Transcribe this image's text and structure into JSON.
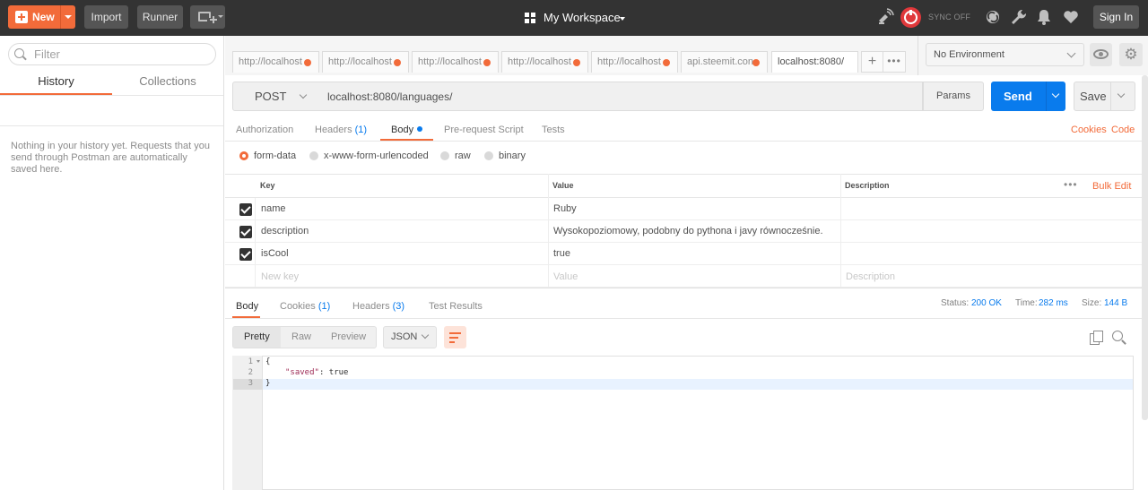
{
  "header": {
    "new_label": "New",
    "import_label": "Import",
    "runner_label": "Runner",
    "workspace": "My Workspace",
    "sync_status": "SYNC OFF",
    "sign_in_label": "Sign In"
  },
  "sidebar": {
    "filter_placeholder": "Filter",
    "tabs": [
      {
        "label": "History",
        "active": true
      },
      {
        "label": "Collections",
        "active": false
      }
    ],
    "empty_message": "Nothing in your history yet. Requests that you send through Postman are automatically saved here."
  },
  "request_tabs": [
    {
      "label": "http://localhost",
      "unsaved": true
    },
    {
      "label": "http://localhost",
      "unsaved": true
    },
    {
      "label": "http://localhost",
      "unsaved": true
    },
    {
      "label": "http://localhost",
      "unsaved": true
    },
    {
      "label": "http://localhost",
      "unsaved": true
    },
    {
      "label": "api.steemit.con",
      "unsaved": true
    },
    {
      "label": "localhost:8080/",
      "unsaved": false,
      "active": true
    }
  ],
  "environment": {
    "selected": "No Environment"
  },
  "request": {
    "method": "POST",
    "url": "localhost:8080/languages/",
    "params_label": "Params",
    "send_label": "Send",
    "save_label": "Save"
  },
  "request_subtabs": [
    {
      "label": "Authorization",
      "count": ""
    },
    {
      "label": "Headers",
      "count": "(1)"
    },
    {
      "label": "Body",
      "count": "",
      "active": true
    },
    {
      "label": "Pre-request Script",
      "count": ""
    },
    {
      "label": "Tests",
      "count": ""
    }
  ],
  "links": {
    "cookies": "Cookies",
    "code": "Code"
  },
  "body_types": [
    {
      "label": "form-data",
      "selected": true
    },
    {
      "label": "x-www-form-urlencoded",
      "selected": false
    },
    {
      "label": "raw",
      "selected": false
    },
    {
      "label": "binary",
      "selected": false
    }
  ],
  "kv_table": {
    "headers": [
      "Key",
      "Value",
      "Description"
    ],
    "bulk_edit": "Bulk Edit",
    "rows": [
      {
        "key": "name",
        "value": "Ruby",
        "checked": true
      },
      {
        "key": "description",
        "value": "Wysokopoziomowy, podobny do pythona i javy równocześnie.",
        "checked": true
      },
      {
        "key": "isCool",
        "value": "true",
        "checked": true
      }
    ],
    "placeholder": {
      "key": "New key",
      "value": "Value",
      "description": "Description"
    }
  },
  "response": {
    "tabs": [
      {
        "label": "Body",
        "count": "",
        "active": true
      },
      {
        "label": "Cookies",
        "count": "(1)"
      },
      {
        "label": "Headers",
        "count": "(3)"
      },
      {
        "label": "Test Results",
        "count": ""
      }
    ],
    "status_label": "Status:",
    "status_value": "200 OK",
    "time_label": "Time:",
    "time_value": "282 ms",
    "size_label": "Size:",
    "size_value": "144 B",
    "view_modes": [
      "Pretty",
      "Raw",
      "Preview"
    ],
    "format": "JSON",
    "lines": [
      "1",
      "2",
      "3"
    ],
    "code": {
      "open": "{",
      "key": "\"saved\"",
      "sep": ": ",
      "val": "true",
      "close": "}"
    }
  },
  "colors": {
    "accent": "#f26b3a",
    "send": "#097bed",
    "header_bg": "#333333"
  }
}
